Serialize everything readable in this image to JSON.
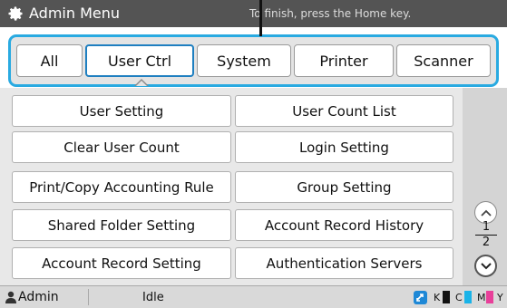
{
  "header": {
    "title": "Admin Menu",
    "hint": "To finish, press the Home key."
  },
  "tabs": [
    {
      "label": "All"
    },
    {
      "label": "User Ctrl",
      "active": true
    },
    {
      "label": "System"
    },
    {
      "label": "Printer"
    },
    {
      "label": "Scanner"
    }
  ],
  "menu": {
    "items": [
      {
        "label": "User Setting"
      },
      {
        "label": "User Count List"
      },
      {
        "label": "Clear User Count"
      },
      {
        "label": "Login Setting"
      },
      {
        "label": "Print/Copy Accounting Rule"
      },
      {
        "label": "Group Setting"
      },
      {
        "label": "Shared Folder Setting"
      },
      {
        "label": "Account Record History"
      },
      {
        "label": "Account Record Setting"
      },
      {
        "label": "Authentication Servers"
      }
    ]
  },
  "pager": {
    "current": "1",
    "total": "2",
    "up_icon": "chevron-up-icon",
    "down_icon": "chevron-down-icon"
  },
  "status": {
    "user": "Admin",
    "state": "Idle",
    "sync_icon": "sync-icon",
    "inks": [
      {
        "label": "K",
        "color": "#111111"
      },
      {
        "label": "C",
        "color": "#1ab3e8"
      },
      {
        "label": "M",
        "color": "#e8409a"
      },
      {
        "label": "Y",
        "color": "#f5d20a"
      }
    ]
  },
  "colors": {
    "accent": "#29aae1",
    "header_bg": "#545454"
  }
}
